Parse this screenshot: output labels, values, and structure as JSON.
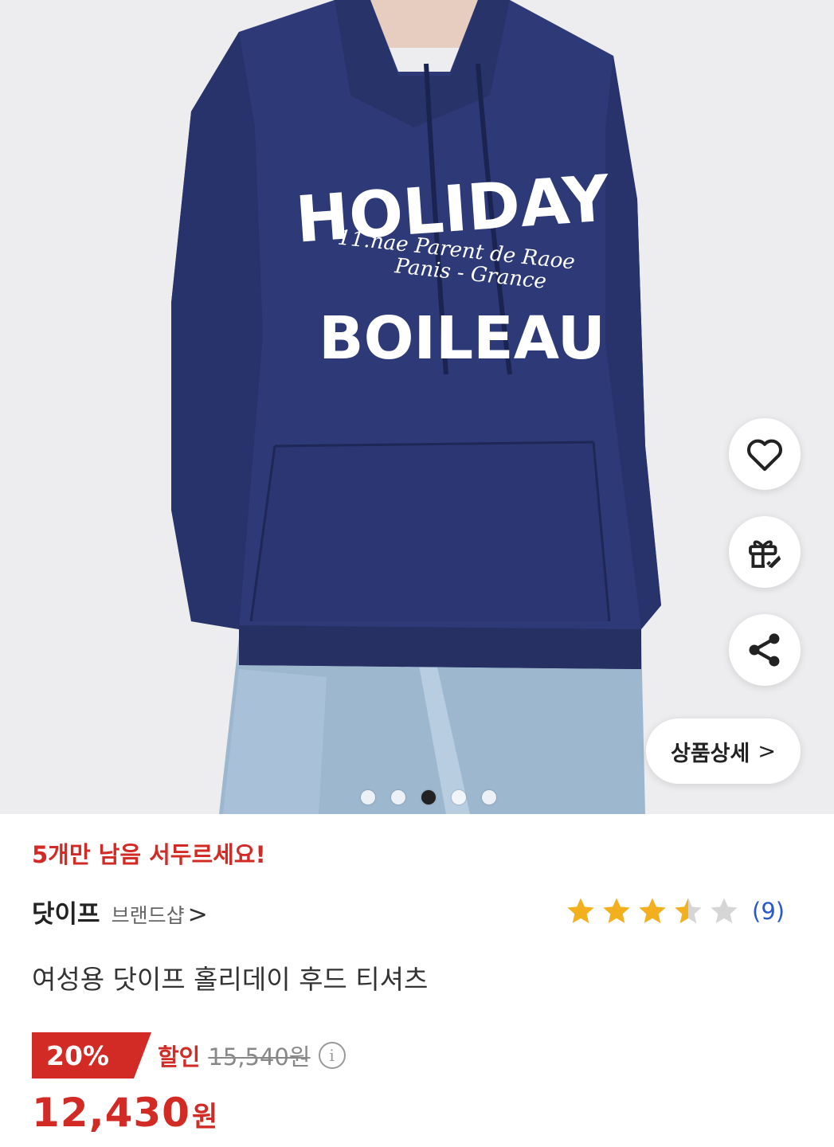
{
  "product_image": {
    "print_line1": "HOLIDAY",
    "print_line2": "11.nae Parent de Raoe",
    "print_line3": "Panis - Grance",
    "print_line4": "BOILEAU",
    "current_slide": 3,
    "total_slides": 5
  },
  "actions": {
    "like_icon": "heart-icon",
    "gift_icon": "gift-icon",
    "share_icon": "share-icon",
    "detail_label": "상품상세",
    "detail_chevron": ">"
  },
  "stock_notice": "5개만 남음 서두르세요!",
  "brand": {
    "name": "닷이프",
    "shop_label": "브랜드샵",
    "shop_chevron": ">"
  },
  "rating": {
    "value": 3.5,
    "max": 5,
    "review_count": "(9)"
  },
  "product_title": "여성용 닷이프 홀리데이 후드 티셔츠",
  "pricing": {
    "discount_badge": "20%",
    "discount_label": "할인",
    "original_price": "15,540원",
    "info_icon": "i",
    "sale_price": "12,430",
    "currency": "원"
  },
  "colors": {
    "accent_red": "#d22b26",
    "star_gold": "#f2b01e",
    "star_empty": "#d6d6d6",
    "link_blue": "#2a59c9",
    "hoodie_navy": "#2e3a78"
  }
}
